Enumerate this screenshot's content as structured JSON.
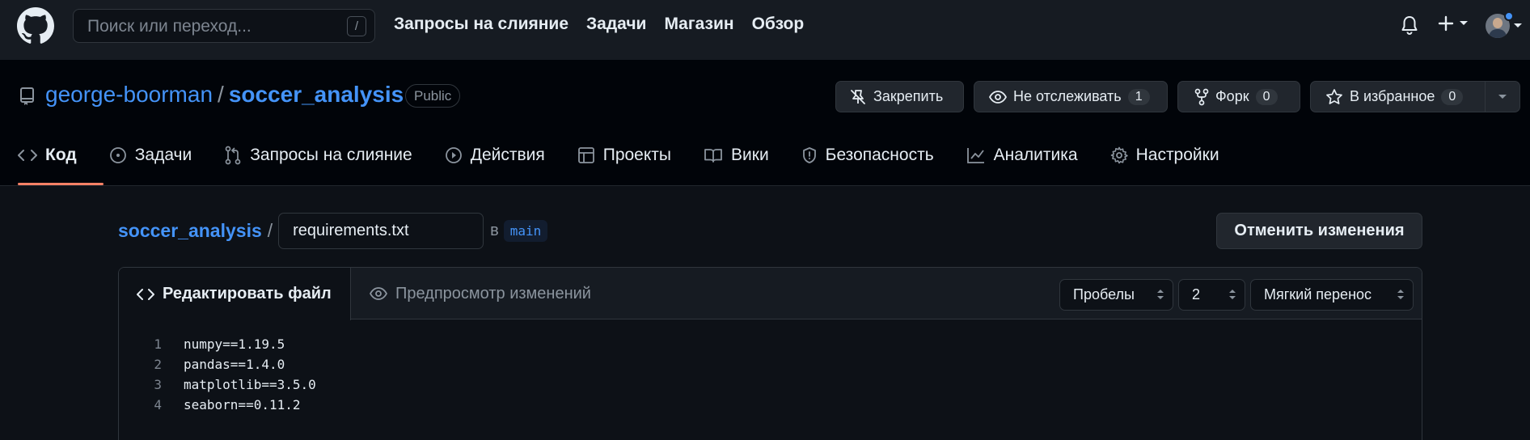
{
  "header": {
    "search_placeholder": "Поиск или переход...",
    "search_shortcut": "/",
    "nav": [
      "Запросы на слияние",
      "Задачи",
      "Магазин",
      "Обзор"
    ],
    "icons": [
      "github-logo-icon",
      "bell-icon",
      "plus-icon",
      "avatar"
    ]
  },
  "repo": {
    "owner": "george-boorman",
    "separator": "/",
    "name": "soccer_analysis",
    "visibility": "Public",
    "actions": {
      "pin_label": "Закрепить",
      "watch_label": "Не отслеживать",
      "watch_count": "1",
      "fork_label": "Форк",
      "fork_count": "0",
      "star_label": "В избранное",
      "star_count": "0"
    },
    "tabs": [
      "Код",
      "Задачи",
      "Запросы на слияние",
      "Действия",
      "Проекты",
      "Вики",
      "Безопасность",
      "Аналитика",
      "Настройки"
    ],
    "active_tab": "Код"
  },
  "editor": {
    "breadcrumb_root": "soccer_analysis",
    "breadcrumb_sep": "/",
    "filename": "requirements.txt",
    "in_word": "в",
    "branch": "main",
    "cancel_label": "Отменить изменения",
    "edit_tab": "Редактировать файл",
    "preview_tab": "Предпросмотр изменений",
    "indent_mode": "Пробелы",
    "indent_size": "2",
    "wrap_mode": "Мягкий перенос",
    "lines": [
      {
        "n": "1",
        "text": "numpy==1.19.5"
      },
      {
        "n": "2",
        "text": "pandas==1.4.0"
      },
      {
        "n": "3",
        "text": "matplotlib==3.5.0"
      },
      {
        "n": "4",
        "text": "seaborn==0.11.2"
      }
    ]
  },
  "colors": {
    "background": "#0d1117",
    "header_bg": "#161b22",
    "link": "#4493f8",
    "active_tab_underline": "#f78166",
    "border": "#30363d"
  }
}
